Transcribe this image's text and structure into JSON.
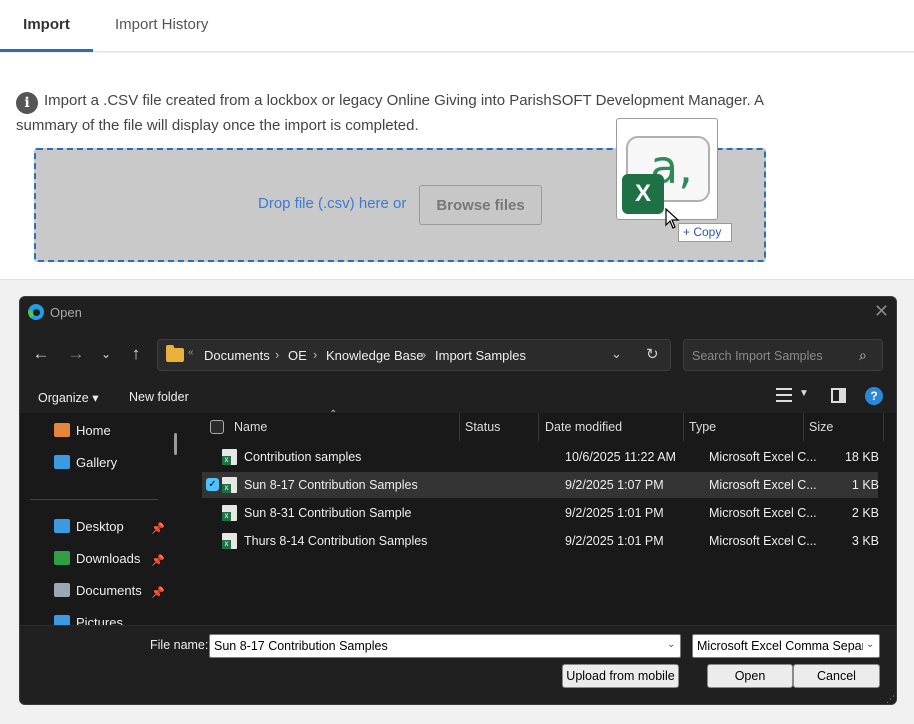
{
  "tabs": [
    {
      "label": "Import"
    },
    {
      "label": "Import History"
    }
  ],
  "info": {
    "icon": "info-icon",
    "text": "Import a .CSV file created from a lockbox or legacy Online Giving into ParishSOFT Development Manager. A summary of the file will display once the import is completed."
  },
  "dropzone": {
    "prompt": "Drop file (.csv) here or",
    "browse_label": "Browse files"
  },
  "drag": {
    "copy_label": "+ Copy",
    "badge": "X",
    "glyph": "a,"
  },
  "dialog": {
    "title": "Open",
    "breadcrumb": [
      "Documents",
      "OE",
      "Knowledge Base",
      "Import Samples"
    ],
    "search_placeholder": "Search Import Samples",
    "organize_label": "Organize ▾",
    "new_folder_label": "New folder",
    "sidebar": [
      {
        "label": "Home",
        "icon": "home-icon",
        "color": "#e8853a"
      },
      {
        "label": "Gallery",
        "icon": "gallery-icon",
        "color": "#3b9be0"
      },
      {
        "label": "Desktop",
        "icon": "desktop-icon",
        "color": "#3b9be0",
        "pinned": true
      },
      {
        "label": "Downloads",
        "icon": "download-icon",
        "color": "#2ea043",
        "pinned": true
      },
      {
        "label": "Documents",
        "icon": "documents-icon",
        "color": "#9aa7b5",
        "pinned": true
      },
      {
        "label": "Pictures",
        "icon": "pictures-icon",
        "color": "#3b9be0"
      }
    ],
    "columns": [
      "Name",
      "Status",
      "Date modified",
      "Type",
      "Size"
    ],
    "files": [
      {
        "name": "Contribution samples",
        "date": "10/6/2025 11:22 AM",
        "type": "Microsoft Excel C...",
        "size": "18 KB",
        "selected": false
      },
      {
        "name": "Sun 8-17 Contribution Samples",
        "date": "9/2/2025 1:07 PM",
        "type": "Microsoft Excel C...",
        "size": "1 KB",
        "selected": true
      },
      {
        "name": "Sun 8-31 Contribution Sample",
        "date": "9/2/2025 1:01 PM",
        "type": "Microsoft Excel C...",
        "size": "2 KB",
        "selected": false
      },
      {
        "name": "Thurs 8-14 Contribution Samples",
        "date": "9/2/2025 1:01 PM",
        "type": "Microsoft Excel C...",
        "size": "3 KB",
        "selected": false
      }
    ],
    "file_name_label": "File name:",
    "file_name_value": "Sun 8-17 Contribution Samples",
    "file_type_value": "Microsoft Excel Comma Separated Values File",
    "upload_label": "Upload from mobile",
    "open_label": "Open",
    "cancel_label": "Cancel"
  }
}
